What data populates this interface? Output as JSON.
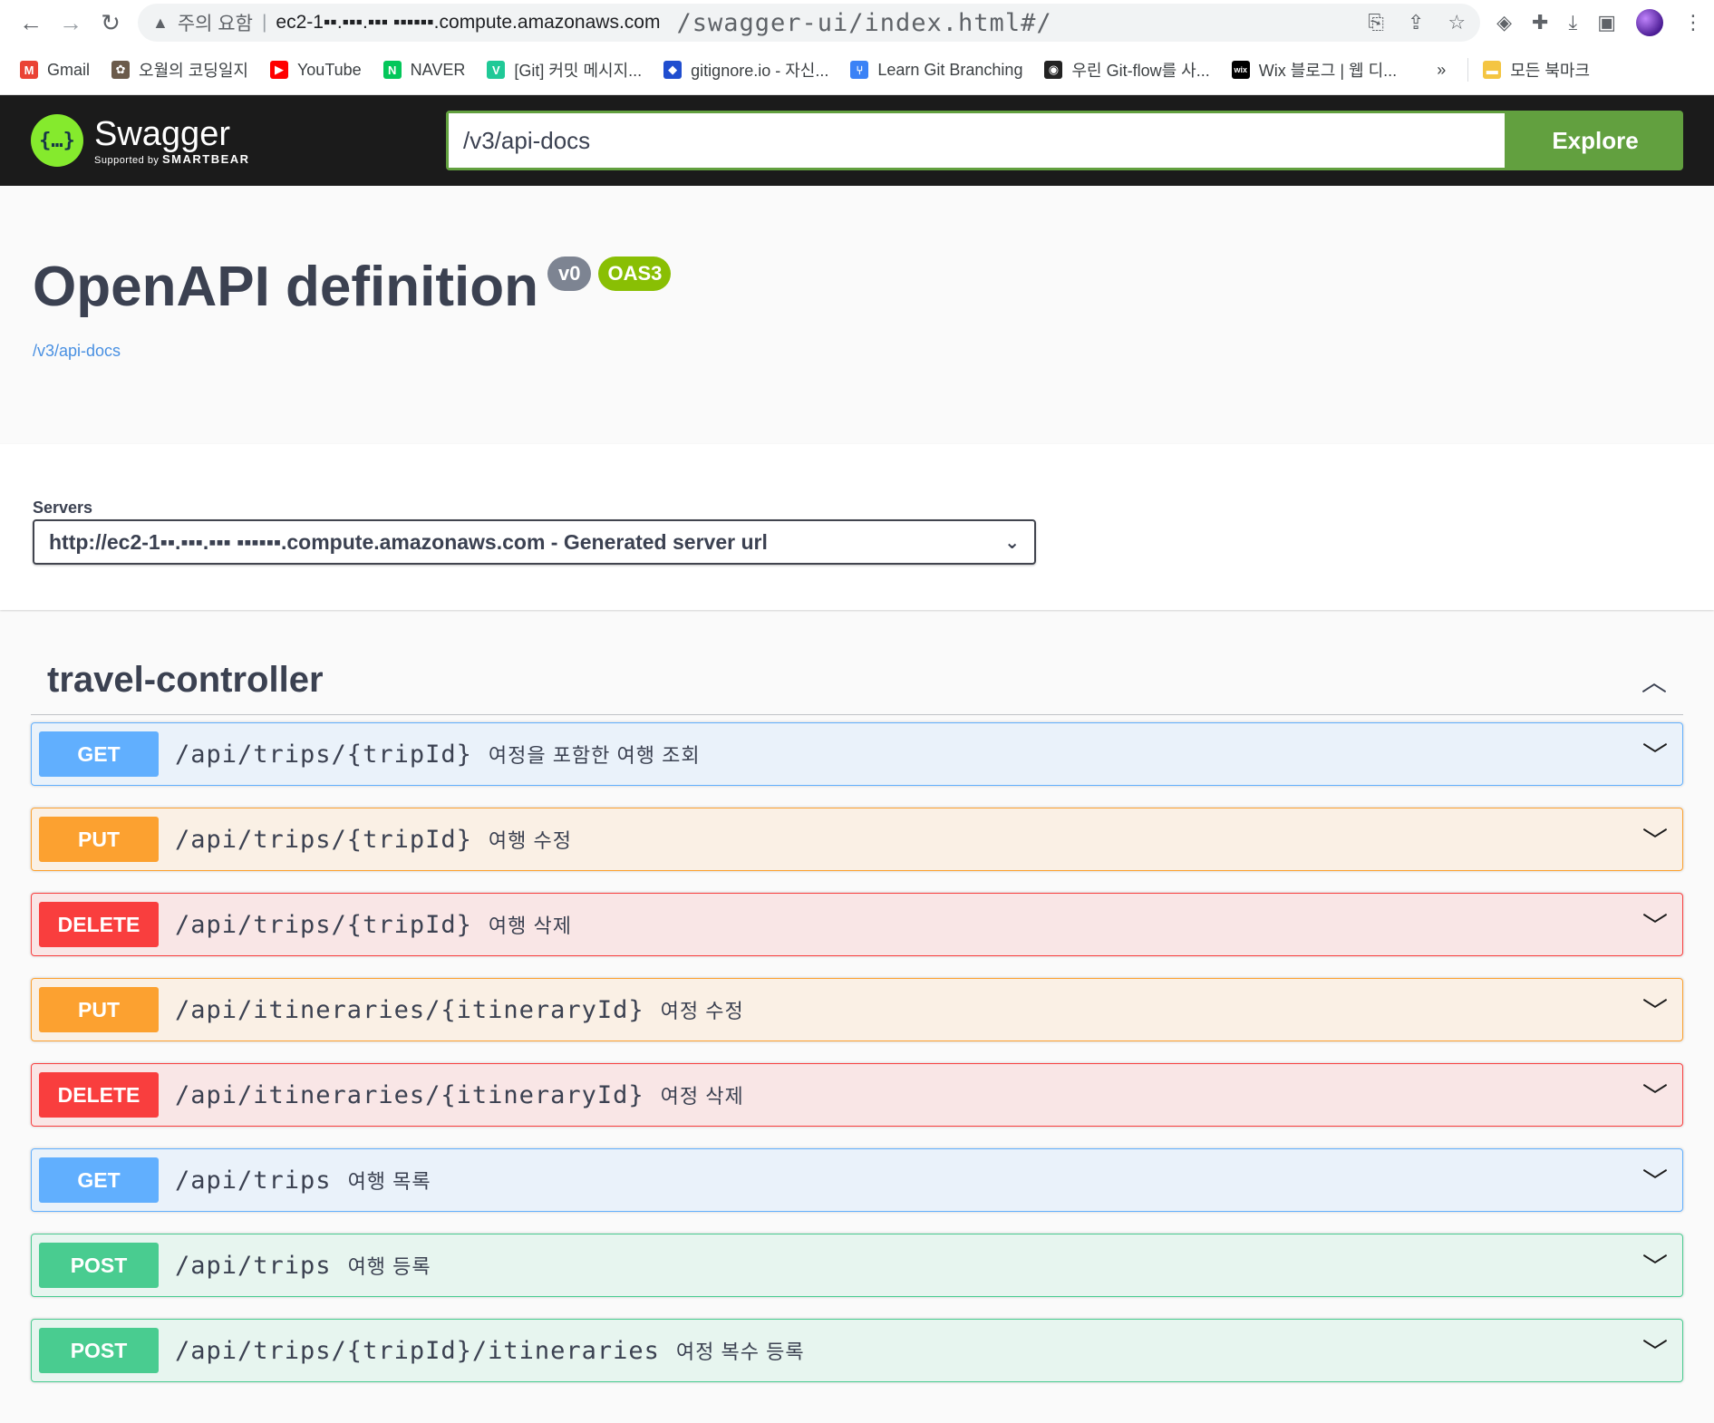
{
  "browser": {
    "security_label": "주의 요함",
    "url_host": "ec2-1▪▪.▪▪▪.▪▪▪ ▪▪▪▪▪▪.compute.amazonaws.com",
    "url_path": "/swagger-ui/index.html#/",
    "nav_icons": [
      "back-icon",
      "forward-icon",
      "reload-icon"
    ],
    "bookmarks": [
      {
        "label": "Gmail",
        "icon": "gmail-icon",
        "color": "#ea4335"
      },
      {
        "label": "오월의 코딩일지",
        "icon": "blog-icon",
        "color": "#6b5b4b"
      },
      {
        "label": "YouTube",
        "icon": "youtube-icon",
        "color": "#ff0000"
      },
      {
        "label": "NAVER",
        "icon": "naver-icon",
        "color": "#03c75a"
      },
      {
        "label": "[Git] 커밋 메시지...",
        "icon": "velog-icon",
        "color": "#20c997"
      },
      {
        "label": "gitignore.io - 자신...",
        "icon": "gitignore-icon",
        "color": "#204ecf"
      },
      {
        "label": "Learn Git Branching",
        "icon": "git-branching-icon",
        "color": "#3b82f6"
      },
      {
        "label": "우린 Git-flow를 사...",
        "icon": "woowa-icon",
        "color": "#222222"
      },
      {
        "label": "Wix 블로그 | 웹 디...",
        "icon": "wix-icon",
        "color": "#000000"
      }
    ],
    "bookmarks_overflow": "»",
    "all_bookmarks": "모든 북마크"
  },
  "topbar": {
    "logo_name": "Swagger",
    "logo_sub_small": "Supported by",
    "logo_sub_brand": "SMARTBEAR",
    "search_value": "/v3/api-docs",
    "explore_label": "Explore"
  },
  "info": {
    "title": "OpenAPI definition",
    "version_badge": "v0",
    "oas_badge": "OAS3",
    "spec_link": "/v3/api-docs"
  },
  "servers": {
    "label": "Servers",
    "selected": "http://ec2-1▪▪.▪▪▪.▪▪▪ ▪▪▪▪▪▪.compute.amazonaws.com - Generated server url"
  },
  "tag": {
    "name": "travel-controller"
  },
  "operations": [
    {
      "method": "GET",
      "path": "/api/trips/{tripId}",
      "summary": "여정을 포함한 여행 조회"
    },
    {
      "method": "PUT",
      "path": "/api/trips/{tripId}",
      "summary": "여행 수정"
    },
    {
      "method": "DELETE",
      "path": "/api/trips/{tripId}",
      "summary": "여행 삭제"
    },
    {
      "method": "PUT",
      "path": "/api/itineraries/{itineraryId}",
      "summary": "여정 수정"
    },
    {
      "method": "DELETE",
      "path": "/api/itineraries/{itineraryId}",
      "summary": "여정 삭제"
    },
    {
      "method": "GET",
      "path": "/api/trips",
      "summary": "여행 목록"
    },
    {
      "method": "POST",
      "path": "/api/trips",
      "summary": "여행 등록"
    },
    {
      "method": "POST",
      "path": "/api/trips/{tripId}/itineraries",
      "summary": "여정 복수 등록"
    }
  ],
  "colors": {
    "get": "#61affe",
    "put": "#fca130",
    "delete": "#f93e3e",
    "post": "#49cc90",
    "topbar": "#1b1b1b",
    "explore": "#62a03f"
  }
}
